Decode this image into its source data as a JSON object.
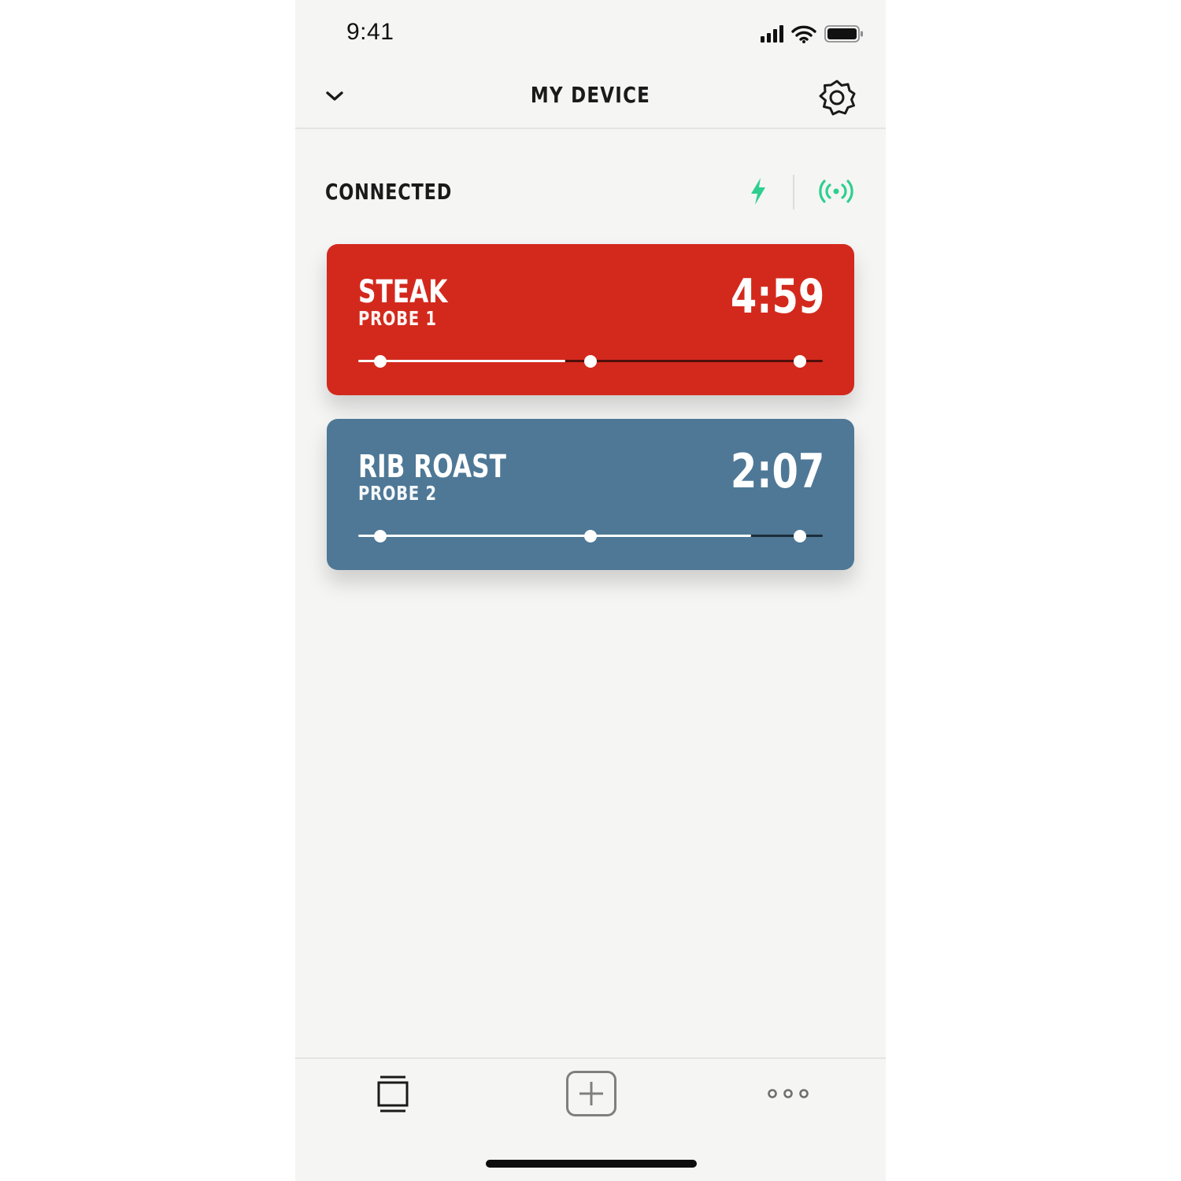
{
  "status_bar": {
    "time": "9:41"
  },
  "header": {
    "title": "MY DEVICE"
  },
  "connection": {
    "label": "CONNECTED",
    "accent_color": "#2ecf8e"
  },
  "probes": [
    {
      "name": "STEAK",
      "probe_label": "PROBE 1",
      "time": "4:59",
      "color": "#d3291d",
      "progress": 0.445,
      "markers": [
        0.047,
        0.5,
        0.95
      ]
    },
    {
      "name": "RIB ROAST",
      "probe_label": "PROBE 2",
      "time": "2:07",
      "color": "#4e7896",
      "progress": 0.845,
      "markers": [
        0.047,
        0.5,
        0.95
      ]
    }
  ],
  "tab_bar": {
    "items": [
      "cards-icon",
      "add-icon",
      "more-icon"
    ]
  }
}
